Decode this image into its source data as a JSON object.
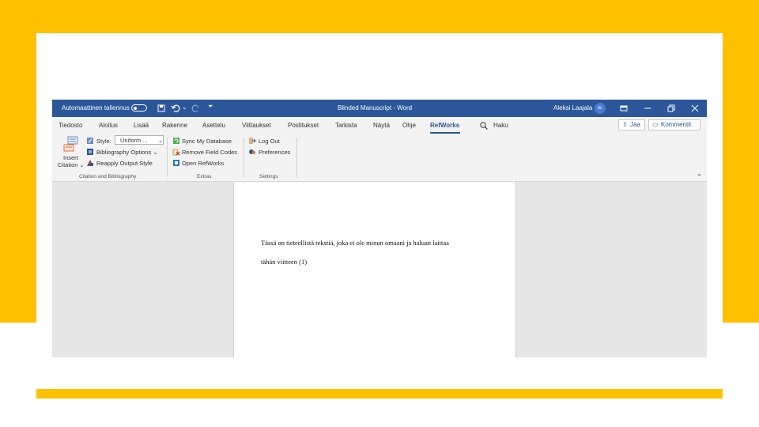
{
  "titlebar": {
    "autosave_label": "Automaattinen tallennus",
    "doc_title": "Blinded Manuscript - Word",
    "user_name": "Aleksi Laajala",
    "user_initials": "AL"
  },
  "tabs": {
    "items": [
      "Tiedosto",
      "Aloitus",
      "Lisää",
      "Rakenne",
      "Asettelu",
      "Viittaukset",
      "Postitukset",
      "Tarkista",
      "Näytä",
      "Ohje",
      "RefWorks"
    ],
    "active": "RefWorks",
    "search_label": "Haku",
    "share_label": "Jaa",
    "comments_label": "Kommentit"
  },
  "ribbon": {
    "insert_citation": {
      "line1": "Insert",
      "line2": "Citation ⌄"
    },
    "style_label": "Style:",
    "style_value": "Uniform ...",
    "bibliography_options": "Bibliography Options ⌄",
    "reapply_output_style": "Reapply Output Style",
    "group_citation": "Citation and Bibliography",
    "sync_my_database": "Sync My Database",
    "remove_field_codes": "Remove Field Codes",
    "open_refworks": "Open RefWorks",
    "group_extras": "Extras",
    "log_out": "Log Out",
    "preferences": "Preferences",
    "group_settings": "Settings"
  },
  "document": {
    "line1": "Tässä on tieteellistä tekstiä, joka ei ole minun omaani ja haluan laittaa",
    "line2": "tähän viitteen (1)"
  },
  "colors": {
    "accent_yellow": "#ffc000",
    "word_blue": "#2b579a"
  },
  "icons": [
    "save-icon",
    "undo-icon",
    "redo-icon",
    "customize-icon",
    "ribbon-display-icon",
    "minimize-icon",
    "restore-icon",
    "close-icon",
    "search-icon",
    "share-icon",
    "comment-icon",
    "insert-citation-icon",
    "style-icon",
    "bibliography-icon",
    "reapply-icon",
    "sync-icon",
    "remove-field-codes-icon",
    "open-refworks-icon",
    "log-out-icon",
    "preferences-icon",
    "collapse-ribbon-icon"
  ]
}
